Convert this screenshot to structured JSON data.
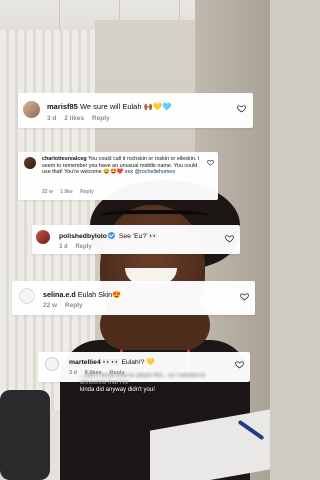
{
  "comments": [
    {
      "username": "marisf85",
      "text": "We sure will Eulah 🙌🏾💛🩵",
      "time": "3 d",
      "likes": "2 likes",
      "reply": "Reply"
    },
    {
      "username": "charlottesrealceg",
      "text": "You could call it rochskin or roskin or elleskin. I seem to remember you have an unusual middle name. You could use that! You're welcome 😅🤩❤️ xxx",
      "mention": "@rochellehumes",
      "time": "22 w",
      "likes": "1 like",
      "reply": "Reply"
    },
    {
      "username": "polishedbylolo",
      "text": "See 'Eu?' 👀",
      "time": "3 d",
      "reply": "Reply"
    },
    {
      "username": "selina.e.d",
      "text": "Eulah Skin😍",
      "time": "22 w",
      "reply": "Reply"
    },
    {
      "username": "martellie4",
      "text": "👀👀 Eulah!? 💛",
      "time": "3 d",
      "likes": "8 likes",
      "reply": "Reply"
    }
  ],
  "caption": {
    "line1": "...didn't know how to attack this.. so I wanted to announce that i've",
    "line2": "kinda did anyway didn't you!"
  },
  "colors": {
    "meta_grey": "#8e8e8e",
    "verified_blue": "#3897f0",
    "mention_blue": "#00376b",
    "heart_outline": "#262626"
  },
  "icons": {
    "like": "heart-outline-icon",
    "verified": "verified-badge-icon"
  }
}
